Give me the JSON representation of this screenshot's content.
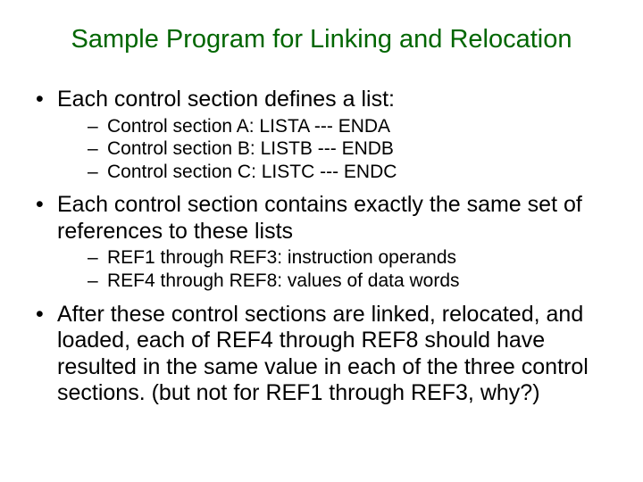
{
  "title": "Sample Program for Linking and Relocation",
  "bullets": {
    "b1": "Each control section defines a list:",
    "b1_sub": {
      "s1": "Control section A: LISTA --- ENDA",
      "s2": "Control section B: LISTB --- ENDB",
      "s3": "Control section C: LISTC --- ENDC"
    },
    "b2": "Each control section contains exactly the same set of references to these lists",
    "b2_sub": {
      "s1": "REF1 through REF3: instruction operands",
      "s2": "REF4 through REF8: values of data words"
    },
    "b3": "After these control sections are linked, relocated, and loaded, each of REF4 through REF8 should have resulted in the same value in each of the three control sections. (but not for REF1 through REF3, why?)"
  }
}
